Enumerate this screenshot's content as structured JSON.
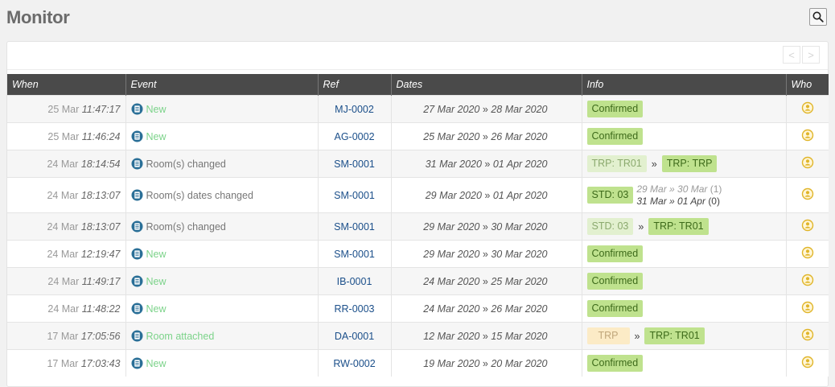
{
  "page": {
    "title": "Monitor"
  },
  "pager": {
    "prev": "<",
    "next": ">"
  },
  "table": {
    "headers": {
      "when": "When",
      "event": "Event",
      "ref": "Ref",
      "dates": "Dates",
      "info": "Info",
      "who": "Who"
    },
    "rows": [
      {
        "when_date": "25 Mar",
        "when_time": "11:47:17",
        "event": "New",
        "event_green": true,
        "ref": "MJ-0002",
        "date_from": "27 Mar 2020",
        "date_sep": "»",
        "date_to": "28 Mar 2020",
        "info": {
          "kind": "confirmed",
          "label": "Confirmed"
        }
      },
      {
        "when_date": "25 Mar",
        "when_time": "11:46:24",
        "event": "New",
        "event_green": true,
        "ref": "AG-0002",
        "date_from": "25 Mar 2020",
        "date_sep": "»",
        "date_to": "26 Mar 2020",
        "info": {
          "kind": "confirmed",
          "label": "Confirmed"
        }
      },
      {
        "when_date": "24 Mar",
        "when_time": "18:14:54",
        "event": "Room(s) changed",
        "event_green": false,
        "ref": "SM-0001",
        "date_from": "31 Mar 2020",
        "date_sep": "»",
        "date_to": "01 Apr 2020",
        "info": {
          "kind": "change",
          "from": "TRP: TR01",
          "from_style": "light",
          "arrow": "»",
          "to": "TRP: TRP"
        }
      },
      {
        "when_date": "24 Mar",
        "when_time": "18:13:07",
        "event": "Room(s) dates changed",
        "event_green": false,
        "ref": "SM-0001",
        "date_from": "29 Mar 2020",
        "date_sep": "»",
        "date_to": "01 Apr 2020",
        "info": {
          "kind": "dates",
          "badge": "STD: 03",
          "line1": "29 Mar » 30 Mar",
          "line1_count": "(1)",
          "line2": "31 Mar » 01 Apr",
          "line2_count": "(0)"
        }
      },
      {
        "when_date": "24 Mar",
        "when_time": "18:13:07",
        "event": "Room(s) changed",
        "event_green": false,
        "ref": "SM-0001",
        "date_from": "29 Mar 2020",
        "date_sep": "»",
        "date_to": "30 Mar 2020",
        "info": {
          "kind": "change",
          "from": "STD: 03",
          "from_style": "light",
          "arrow": "»",
          "to": "TRP: TR01"
        }
      },
      {
        "when_date": "24 Mar",
        "when_time": "12:19:47",
        "event": "New",
        "event_green": true,
        "ref": "SM-0001",
        "date_from": "29 Mar 2020",
        "date_sep": "»",
        "date_to": "30 Mar 2020",
        "info": {
          "kind": "confirmed",
          "label": "Confirmed"
        }
      },
      {
        "when_date": "24 Mar",
        "when_time": "11:49:17",
        "event": "New",
        "event_green": true,
        "ref": "IB-0001",
        "date_from": "24 Mar 2020",
        "date_sep": "»",
        "date_to": "25 Mar 2020",
        "info": {
          "kind": "confirmed",
          "label": "Confirmed"
        }
      },
      {
        "when_date": "24 Mar",
        "when_time": "11:48:22",
        "event": "New",
        "event_green": true,
        "ref": "RR-0003",
        "date_from": "24 Mar 2020",
        "date_sep": "»",
        "date_to": "26 Mar 2020",
        "info": {
          "kind": "confirmed",
          "label": "Confirmed"
        }
      },
      {
        "when_date": "17 Mar",
        "when_time": "17:05:56",
        "event": "Room attached",
        "event_green": true,
        "ref": "DA-0001",
        "date_from": "12 Mar 2020",
        "date_sep": "»",
        "date_to": "15 Mar 2020",
        "info": {
          "kind": "change",
          "from": "TRP",
          "from_style": "peach",
          "arrow": "»",
          "to": "TRP: TR01"
        }
      },
      {
        "when_date": "17 Mar",
        "when_time": "17:03:43",
        "event": "New",
        "event_green": true,
        "ref": "RW-0002",
        "date_from": "19 Mar 2020",
        "date_sep": "»",
        "date_to": "20 Mar 2020",
        "info": {
          "kind": "confirmed",
          "label": "Confirmed"
        }
      }
    ]
  },
  "colors": {
    "header_bg": "#4a4a4a",
    "confirmed_bg": "#bfe28e",
    "ref_link": "#1b4f8a",
    "event_new": "#7cd38a",
    "user_icon": "#e0b529"
  },
  "icons": {
    "search": "search-icon",
    "event": "document-icon",
    "who": "user-icon"
  }
}
